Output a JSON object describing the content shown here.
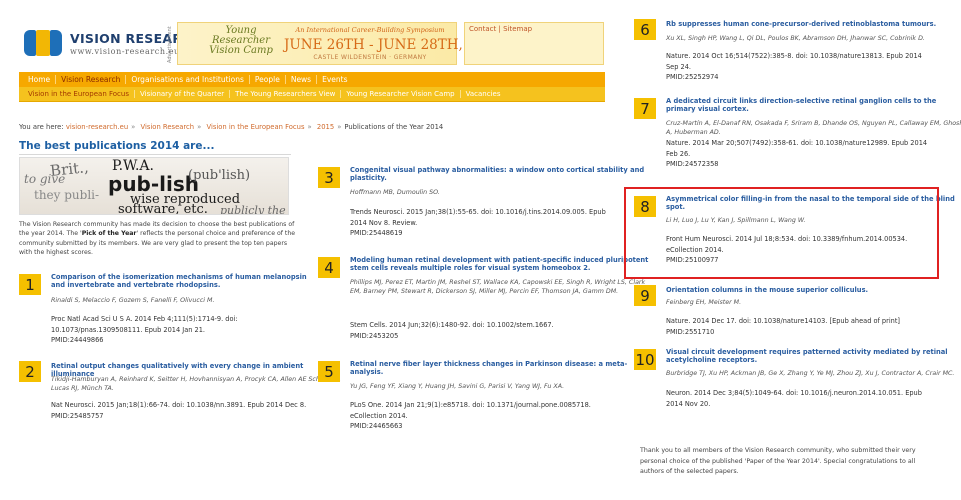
{
  "header": {
    "brand_name": "VISION RESEARCH",
    "brand_url": "www.vision-research.eu",
    "advert_tag": "Advertisement",
    "banner": {
      "logo_text": "Young Researcher Vision Camp",
      "line1": "An International Career-Building Symposium",
      "dates": "JUNE 26TH - JUNE 28TH, 2020",
      "location": "CASTLE WILDENSTEIN · GERMANY"
    },
    "contact_link": "Contact",
    "sitemap_link": "Sitemap"
  },
  "nav": {
    "main": [
      "Home",
      "Vision Research",
      "Organisations and Institutions",
      "People",
      "News",
      "Events"
    ],
    "main_active": "Vision Research",
    "sub": [
      "Vision in the European Focus",
      "Visionary of the Quarter",
      "The Young Researchers View",
      "Young Researcher Vision Camp",
      "Vacancies"
    ],
    "sub_active": "Vision in the European Focus"
  },
  "breadcrumb": {
    "prefix": "You are here:",
    "items": [
      "vision-research.eu",
      "Vision Research",
      "Vision in the European Focus",
      "2015"
    ],
    "current": "Publications of the Year 2014"
  },
  "page": {
    "title": "The best publications 2014 are..."
  },
  "hero_words": [
    "to give",
    "they publi-",
    "P.W.A.",
    "pub-lish",
    "(pub'lish)",
    "wise reproduced",
    "software, etc.",
    "Brit.,",
    "publicly the"
  ],
  "intro": {
    "part1": "The Vision Research community has made its decision to choose the best publications of the year 2014. The '",
    "bold": "Pick of the Year",
    "part2": "' reflects the personal choice and preference of the community submitted by its members. We are very glad to present the top ten papers with the highest scores."
  },
  "entries": [
    {
      "n": "1",
      "title": "Comparison of the isomerization mechanisms of human melanopsin and invertebrate and vertebrate rhodopsins.",
      "authors": "Rinaldi S, Melaccio F, Gozem S, Fanelli F, Olivucci M.",
      "cite": [
        "Proc Natl Acad Sci U S A. 2014 Feb 4;111(5):1714-9. doi:",
        "10.1073/pnas.1309508111. Epub 2014 Jan 21.",
        "PMID:24449866"
      ]
    },
    {
      "n": "2",
      "title": "Retinal output changes qualitatively with every change in ambient illuminance",
      "authors": "Tikidji-Hamburyan A, Reinhard K, Seitter H, Hovhannisyan A, Procyk CA, Allen AE Schenk M, Lucas RJ, Münch TA.",
      "cite": [
        "Nat Neurosci. 2015 Jan;18(1):66-74. doi: 10.1038/nn.3891. Epub 2014 Dec 8.",
        "PMID:25485757"
      ]
    },
    {
      "n": "3",
      "title": "Congenital visual pathway abnormalities: a window onto cortical stability and plasticity.",
      "authors": "Hoffmann MB, Dumoulin SO.",
      "cite": [
        "Trends Neurosci. 2015 Jan;38(1):55-65. doi: 10.1016/j.tins.2014.09.005. Epub",
        "2014 Nov 8. Review.",
        "PMID:25448619"
      ]
    },
    {
      "n": "4",
      "title": "Modeling human retinal development with patient-specific induced pluripotent stem cells reveals multiple roles for visual system homeobox 2.",
      "authors": "Phillips MJ, Perez ET, Martin JM, Reshel ST, Wallace KA, Capowski EE, Singh R, Wright LS, Clark EM, Barney PM, Stewart R, Dickerson SJ, Miller MJ, Percin EF, Thomson JA, Gamm DM.",
      "cite": [
        "Stem Cells. 2014 Jun;32(6):1480-92. doi: 10.1002/stem.1667.",
        "PMID:2453205"
      ]
    },
    {
      "n": "5",
      "title": "Retinal nerve fiber layer thickness changes in Parkinson disease: a meta-analysis.",
      "authors": "Yu JG, Feng YF, Xiang Y, Huang JH, Savini G, Parisi V, Yang WJ, Fu XA.",
      "cite": [
        "PLoS One. 2014 Jan 21;9(1):e85718. doi: 10.1371/journal.pone.0085718.",
        "eCollection 2014.",
        "PMID:24465663"
      ]
    },
    {
      "n": "6",
      "title": "Rb suppresses human cone-precursor-derived retinoblastoma tumours.",
      "authors": "Xu XL, Singh HP, Wang L, Qi DL, Poulos BK, Abramson DH, Jhanwar SC, Cobrinik D.",
      "cite": [
        "Nature. 2014 Oct 16;514(7522):385-8. doi: 10.1038/nature13813. Epub 2014",
        "Sep 24.",
        "PMID:25252974"
      ]
    },
    {
      "n": "7",
      "title": "A dedicated circuit links direction-selective retinal ganglion cells to the primary visual cortex.",
      "authors": "Cruz-Martín A, El-Danaf RN, Osakada F, Sriram B, Dhande OS, Nguyen PL, Callaway EM, Ghosh A, Huberman AD.",
      "cite": [
        "Nature. 2014 Mar 20;507(7492):358-61. doi: 10.1038/nature12989. Epub 2014",
        "Feb 26.",
        "PMID:24572358"
      ]
    },
    {
      "n": "8",
      "title": "Asymmetrical color filling-in from the nasal to the temporal side of the blind spot.",
      "authors": "Li H, Luo J, Lu Y, Kan J, Spillmann L, Wang W.",
      "cite": [
        "Front Hum Neurosci. 2014 Jul 18;8:534. doi: 10.3389/fnhum.2014.00534.",
        "eCollection 2014.",
        "PMID:25100977"
      ]
    },
    {
      "n": "9",
      "title": "Orientation columns in the mouse superior colliculus.",
      "authors": "Feinberg EH, Meister M.",
      "cite": [
        "Nature. 2014 Dec 17. doi: 10.1038/nature14103. [Epub ahead of print]",
        "PMID:2551710"
      ]
    },
    {
      "n": "10",
      "title": "Visual circuit development requires patterned activity mediated by retinal acetylcholine receptors.",
      "authors": "Burbridge TJ, Xu HP, Ackman JB, Ge X, Zhang Y, Ye MJ, Zhou ZJ, Xu J, Contractor A, Crair MC.",
      "cite": [
        "Neuron. 2014 Dec 3;84(5):1049-64. doi: 10.1016/j.neuron.2014.10.051. Epub",
        "2014 Nov 20."
      ]
    }
  ],
  "thanks": "Thank you to all members of the Vision Research community, who submitted their very personal choice of the published 'Paper of the Year 2014'. Special congratulations to all authors of the selected papers.",
  "colors": {
    "accent": "#f6a800",
    "link": "#2a5da0",
    "highlight": "#e02121",
    "badge": "#f5c000"
  }
}
